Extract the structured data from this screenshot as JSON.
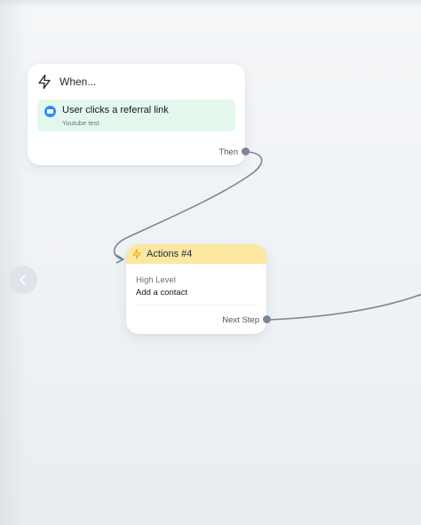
{
  "trigger": {
    "title": "When...",
    "event_label": "User clicks a referral link",
    "event_source": "Youtube test",
    "output_label": "Then",
    "icon": "bolt-icon",
    "app_icon": "messenger-icon"
  },
  "action": {
    "title": "Actions #4",
    "app_name": "High Level",
    "operation": "Add a contact",
    "output_label": "Next Step",
    "icon": "bolt-icon"
  },
  "navigation": {
    "back_icon": "chevron-left-icon"
  },
  "colors": {
    "trigger_item_bg": "#e3f8ec",
    "action_header_bg": "#fce8a0",
    "connector": "#7a879a",
    "app_icon": "#2d8cff",
    "bolt_action": "#e0a800"
  }
}
